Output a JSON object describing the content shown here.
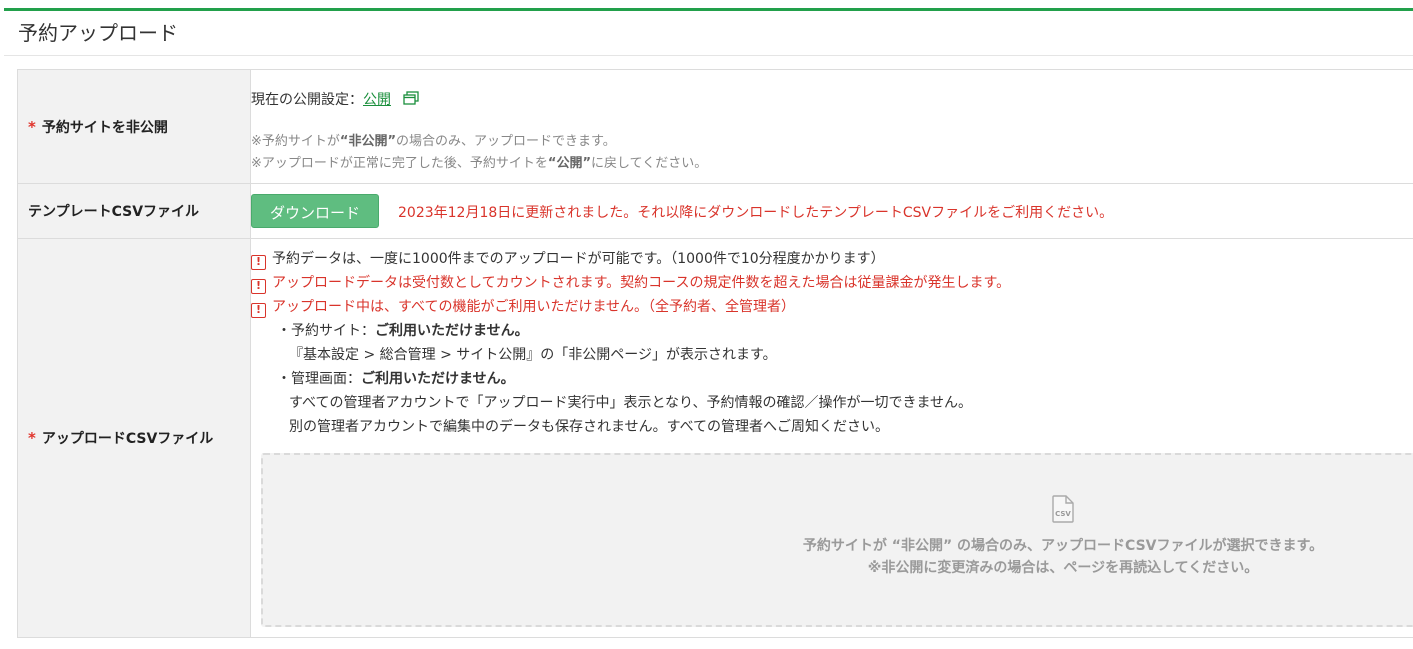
{
  "panel": {
    "title": "予約アップロード"
  },
  "rows": {
    "publish": {
      "label": "予約サイトを非公開",
      "required_mark": "*",
      "current_setting_prefix": "現在の公開設定：",
      "current_setting_value": "公開",
      "note1_pre": "※予約サイトが",
      "note1_bold": "“非公開”",
      "note1_post": "の場合のみ、アップロードできます。",
      "note2_pre": "※アップロードが正常に完了した後、予約サイトを",
      "note2_bold": "“公開”",
      "note2_post": "に戻してください。"
    },
    "template": {
      "label": "テンプレートCSVファイル",
      "download_button": "ダウンロード",
      "update_message": "2023年12月18日に更新されました。それ以降にダウンロードしたテンプレートCSVファイルをご利用ください。"
    },
    "upload": {
      "label": "アップロードCSVファイル",
      "required_mark": "*",
      "warning_icon": "!",
      "notice1": "予約データは、一度に1000件までのアップロードが可能です。（1000件で10分程度かかります）",
      "notice2": "アップロードデータは受付数としてカウントされます。契約コースの規定件数を超えた場合は従量課金が発生します。",
      "notice3": "アップロード中は、すべての機能がご利用いただけません。（全予約者、全管理者）",
      "site_prefix": "・予約サイト：",
      "site_bold": "ご利用いただけません。",
      "site_detail": "『基本設定 > 総合管理 > サイト公開』の「非公開ページ」が表示されます。",
      "admin_prefix": "・管理画面：",
      "admin_bold": "ご利用いただけません。",
      "admin_detail1": "すべての管理者アカウントで「アップロード実行中」表示となり、予約情報の確認／操作が一切できません。",
      "admin_detail2": "別の管理者アカウントで編集中のデータも保存されません。すべての管理者へご周知ください。",
      "dropzone_line1": "予約サイトが “非公開” の場合のみ、アップロードCSVファイルが選択できます。",
      "dropzone_line2": "※非公開に変更済みの場合は、ページを再読込してください。",
      "dropzone_icon": "csv-file-icon",
      "dropzone_icon_text": "CSV"
    }
  },
  "colors": {
    "accent_green": "#22a04b",
    "button_green": "#5fbd80",
    "error_red": "#d9342b",
    "required_red": "#e0342c"
  }
}
